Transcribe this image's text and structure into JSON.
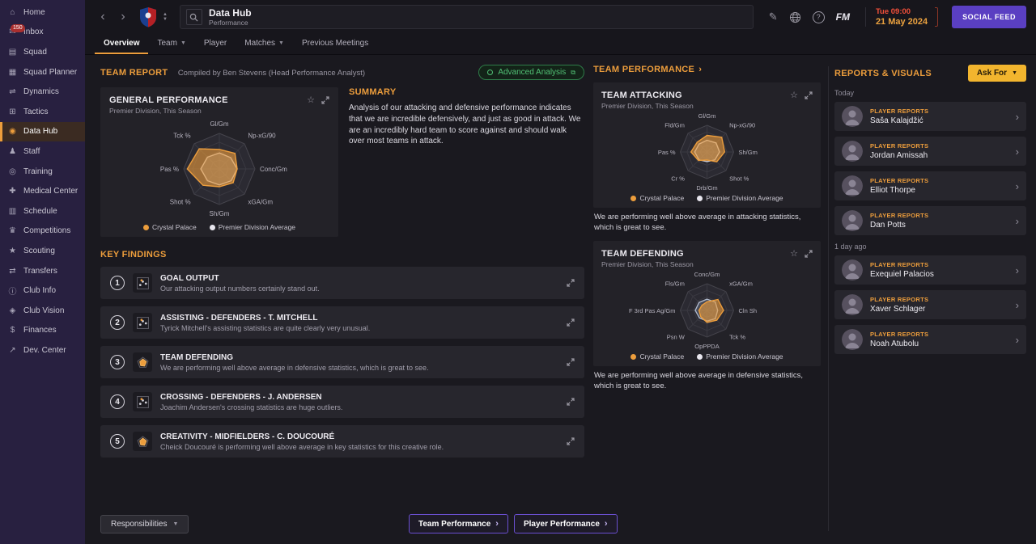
{
  "colors": {
    "accent": "#ec9d3c",
    "purple": "#5a3fc2",
    "green": "#52c175",
    "yellow": "#f2b52e",
    "time_red": "#f4503a"
  },
  "sidebar": {
    "items": [
      {
        "name": "home",
        "label": "Home",
        "icon": "⌂"
      },
      {
        "name": "inbox",
        "label": "Inbox",
        "icon": "✉",
        "badge": "150"
      },
      {
        "name": "squad",
        "label": "Squad",
        "icon": "▤"
      },
      {
        "name": "squad-planner",
        "label": "Squad Planner",
        "icon": "▦"
      },
      {
        "name": "dynamics",
        "label": "Dynamics",
        "icon": "⇌"
      },
      {
        "name": "tactics",
        "label": "Tactics",
        "icon": "⊞"
      },
      {
        "name": "data-hub",
        "label": "Data Hub",
        "icon": "◉",
        "active": true
      },
      {
        "name": "staff",
        "label": "Staff",
        "icon": "♟"
      },
      {
        "name": "training",
        "label": "Training",
        "icon": "◎"
      },
      {
        "name": "medical-center",
        "label": "Medical Center",
        "icon": "✚"
      },
      {
        "name": "schedule",
        "label": "Schedule",
        "icon": "▥"
      },
      {
        "name": "competitions",
        "label": "Competitions",
        "icon": "♛"
      },
      {
        "name": "scouting",
        "label": "Scouting",
        "icon": "★"
      },
      {
        "name": "transfers",
        "label": "Transfers",
        "icon": "⇄"
      },
      {
        "name": "club-info",
        "label": "Club Info",
        "icon": "ⓘ"
      },
      {
        "name": "club-vision",
        "label": "Club Vision",
        "icon": "◈"
      },
      {
        "name": "finances",
        "label": "Finances",
        "icon": "$"
      },
      {
        "name": "dev-center",
        "label": "Dev. Center",
        "icon": "↗"
      }
    ]
  },
  "topbar": {
    "title": "Data Hub",
    "subtitle": "Performance",
    "time": "Tue 09:00",
    "date": "21 May 2024",
    "fm_label": "FM",
    "social_feed_label": "SOCIAL FEED"
  },
  "tabs": [
    {
      "label": "Overview",
      "active": true
    },
    {
      "label": "Team",
      "dropdown": true
    },
    {
      "label": "Player"
    },
    {
      "label": "Matches",
      "dropdown": true
    },
    {
      "label": "Previous Meetings"
    }
  ],
  "team_report": {
    "title": "TEAM REPORT",
    "compiled_by": "Compiled by Ben Stevens (Head Performance Analyst)",
    "advanced_analysis_label": "Advanced Analysis"
  },
  "general_performance": {
    "title": "GENERAL PERFORMANCE",
    "subtitle": "Premier Division, This Season"
  },
  "summary": {
    "title": "SUMMARY",
    "text": "Analysis of our attacking and defensive performance indicates that we are incredible defensively, and just as good in attack. We are an incredibly hard team to score against and should walk over most teams in attack."
  },
  "key_findings": {
    "title": "KEY FINDINGS",
    "items": [
      {
        "num": "1",
        "icon": "scatter",
        "title": "GOAL OUTPUT",
        "text": "Our attacking output numbers certainly stand out."
      },
      {
        "num": "2",
        "icon": "scatter",
        "title": "ASSISTING - DEFENDERS - T. MITCHELL",
        "text": "Tyrick Mitchell's assisting statistics are quite clearly very unusual."
      },
      {
        "num": "3",
        "icon": "radar",
        "title": "TEAM DEFENDING",
        "text": "We are performing well above average in defensive statistics, which is great to see."
      },
      {
        "num": "4",
        "icon": "scatter",
        "title": "CROSSING - DEFENDERS - J. ANDERSEN",
        "text": "Joachim Andersen's crossing statistics are huge outliers."
      },
      {
        "num": "5",
        "icon": "radar",
        "title": "CREATIVITY - MIDFIELDERS - C. DOUCOURÉ",
        "text": "Cheick Doucouré is performing well above average in key statistics for this creative role."
      }
    ]
  },
  "team_performance": {
    "header": "TEAM PERFORMANCE",
    "attacking": {
      "title": "TEAM ATTACKING",
      "subtitle": "Premier Division, This Season",
      "note": "We are performing well above average in attacking statistics, which is great to see."
    },
    "defending": {
      "title": "TEAM DEFENDING",
      "subtitle": "Premier Division, This Season",
      "note": "We are performing well above average in defensive statistics, which is great to see."
    }
  },
  "legend": {
    "entries": [
      {
        "label": "Crystal Palace",
        "color": "#ec9d3c"
      },
      {
        "label": "Premier Division Average",
        "color": "#e8e6ee"
      }
    ]
  },
  "reports_visuals": {
    "title": "REPORTS & VISUALS",
    "ask_for_label": "Ask For",
    "groups": [
      {
        "when": "Today",
        "items": [
          {
            "type": "PLAYER REPORTS",
            "name": "Saša Kalajdžić"
          },
          {
            "type": "PLAYER REPORTS",
            "name": "Jordan Amissah"
          },
          {
            "type": "PLAYER REPORTS",
            "name": "Elliot Thorpe"
          },
          {
            "type": "PLAYER REPORTS",
            "name": "Dan Potts"
          }
        ]
      },
      {
        "when": "1 day ago",
        "items": [
          {
            "type": "PLAYER REPORTS",
            "name": "Exequiel Palacios"
          },
          {
            "type": "PLAYER REPORTS",
            "name": "Xaver Schlager"
          },
          {
            "type": "PLAYER REPORTS",
            "name": "Noah Atubolu"
          }
        ]
      }
    ]
  },
  "footer": {
    "responsibilities_label": "Responsibilities",
    "team_performance_label": "Team Performance",
    "player_performance_label": "Player Performance"
  },
  "chart_data": [
    {
      "type": "radar",
      "title": "GENERAL PERFORMANCE",
      "axes": [
        "Gl/Gm",
        "Np-xG/90",
        "Conc/Gm",
        "xGA/Gm",
        "Sh/Gm",
        "Shot %",
        "Pas %",
        "Tck %"
      ],
      "series": [
        {
          "name": "Premier Division Average",
          "color": "#cfced6",
          "fill": "rgba(210,210,218,0.28)",
          "values": [
            0.45,
            0.45,
            0.5,
            0.47,
            0.45,
            0.47,
            0.52,
            0.47
          ]
        },
        {
          "name": "Crystal Palace",
          "color": "#ec9d3c",
          "fill": "rgba(236,157,60,0.6)",
          "values": [
            0.55,
            0.62,
            0.5,
            0.55,
            0.5,
            0.65,
            0.9,
            0.8
          ]
        }
      ]
    },
    {
      "type": "radar",
      "title": "TEAM ATTACKING",
      "axes": [
        "Gl/Gm",
        "Np-xG/90",
        "Sh/Gm",
        "Shot %",
        "Drb/Gm",
        "Cr %",
        "Pas %",
        "Fld/Gm"
      ],
      "series": [
        {
          "name": "Premier Division Average",
          "color": "#cfced6",
          "fill": "rgba(210,210,218,0.28)",
          "values": [
            0.44,
            0.48,
            0.47,
            0.42,
            0.36,
            0.42,
            0.46,
            0.42
          ]
        },
        {
          "name": "Crystal Palace",
          "color": "#ec9d3c",
          "fill": "rgba(236,157,60,0.6)",
          "values": [
            0.62,
            0.78,
            0.66,
            0.52,
            0.3,
            0.45,
            0.6,
            0.52
          ]
        }
      ]
    },
    {
      "type": "radar",
      "title": "TEAM DEFENDING",
      "axes": [
        "Conc/Gm",
        "xGA/Gm",
        "Cln Sh",
        "Tck %",
        "OpPPDA",
        "Psn W",
        "F 3rd Pas Ag/Gm",
        "Fls/Gm"
      ],
      "series": [
        {
          "name": "Premier Division Average",
          "color": "#aeb8cc",
          "fill": "rgba(150,170,200,0.25)",
          "values": [
            0.42,
            0.44,
            0.4,
            0.44,
            0.4,
            0.4,
            0.44,
            0.42
          ]
        },
        {
          "name": "Crystal Palace",
          "color": "#ec9d3c",
          "fill": "rgba(236,157,60,0.6)",
          "values": [
            0.32,
            0.58,
            0.62,
            0.52,
            0.45,
            0.33,
            0.3,
            0.27
          ]
        }
      ]
    }
  ]
}
